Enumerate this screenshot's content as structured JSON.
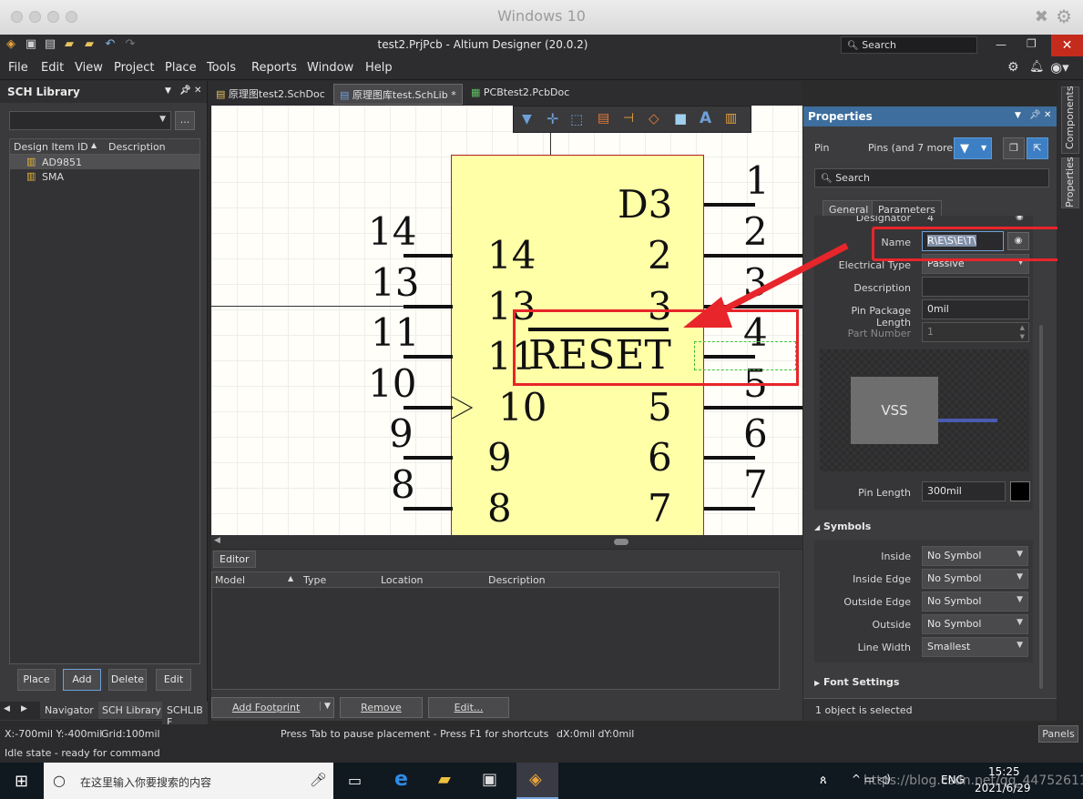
{
  "mac": {
    "title": "Windows 10"
  },
  "app": {
    "title": "test2.PrjPcb - Altium Designer (20.0.2)",
    "search_label": "Search"
  },
  "menu": [
    "File",
    "Edit",
    "View",
    "Project",
    "Place",
    "Tools",
    "Reports",
    "Window",
    "Help"
  ],
  "left_panel": {
    "title": "SCH Library",
    "columns": [
      "Design Item ID",
      "Description"
    ],
    "items": [
      "AD9851",
      "SMA"
    ],
    "buttons": [
      "Place",
      "Add",
      "Delete",
      "Edit"
    ],
    "bottom_tabs": [
      "Navigator",
      "SCH Library",
      "SCHLIB F"
    ]
  },
  "doc_tabs": [
    "原理图test2.SchDoc",
    "原理图库test.SchLib *",
    "PCBtest2.PcbDoc"
  ],
  "canvas": {
    "left_numbers_out": [
      "14",
      "13",
      "11",
      "10",
      "9",
      "8"
    ],
    "left_numbers_in": [
      "14",
      "13",
      "11",
      "10",
      "9",
      "8"
    ],
    "right_numbers_out": [
      "1",
      "2",
      "3",
      "4",
      "5",
      "6",
      "7"
    ],
    "right_numbers_in": [
      "2",
      "3",
      "5",
      "6",
      "7"
    ],
    "d3_label": "D3",
    "reset_label": "RESET"
  },
  "editor": {
    "tab": "Editor",
    "columns": [
      "Model",
      "Type",
      "Location",
      "Description"
    ],
    "buttons": [
      "Add Footprint",
      "Remove",
      "Edit..."
    ]
  },
  "props": {
    "title": "Properties",
    "kind": "Pin",
    "filter_text": "Pins (and 7 more)",
    "search": "Search",
    "tabs": [
      "General",
      "Parameters"
    ],
    "designator_label": "Designator",
    "designator_value": "4",
    "name_label": "Name",
    "name_value": "R\\E\\S\\E\\T\\",
    "electrical_label": "Electrical Type",
    "electrical_value": "Passive",
    "description_label": "Description",
    "pkg_label": "Pin Package Length",
    "pkg_value": "0mil",
    "part_label": "Part Number",
    "part_value": "1",
    "preview_text": "VSS",
    "pin_length_label": "Pin Length",
    "pin_length_value": "300mil",
    "symbols_header": "Symbols",
    "symbols": [
      {
        "label": "Inside",
        "value": "No Symbol"
      },
      {
        "label": "Inside Edge",
        "value": "No Symbol"
      },
      {
        "label": "Outside Edge",
        "value": "No Symbol"
      },
      {
        "label": "Outside",
        "value": "No Symbol"
      },
      {
        "label": "Line Width",
        "value": "Smallest"
      }
    ],
    "font_settings": "Font Settings",
    "selected_text": "1 object is selected",
    "side_tabs": [
      "Components",
      "Properties"
    ]
  },
  "status": {
    "coords": "X:-700mil Y:-400mil",
    "grid": "Grid:100mil",
    "hint": "Press Tab to pause placement - Press F1 for shortcuts",
    "delta": "dX:0mil dY:0mil",
    "panels": "Panels",
    "idle": "Idle state - ready for command"
  },
  "taskbar": {
    "search_placeholder": "在这里输入你要搜索的内容",
    "lang": "ENG",
    "time": "15:25",
    "date": "2021/6/29",
    "watermark": "https://blog.csdn.net/qq_44752611"
  },
  "colors": {
    "accent_red": "#e8252a",
    "component_fill": "#ffffa8",
    "component_border": "#b02020",
    "filter_blue": "#3d7fc4"
  }
}
